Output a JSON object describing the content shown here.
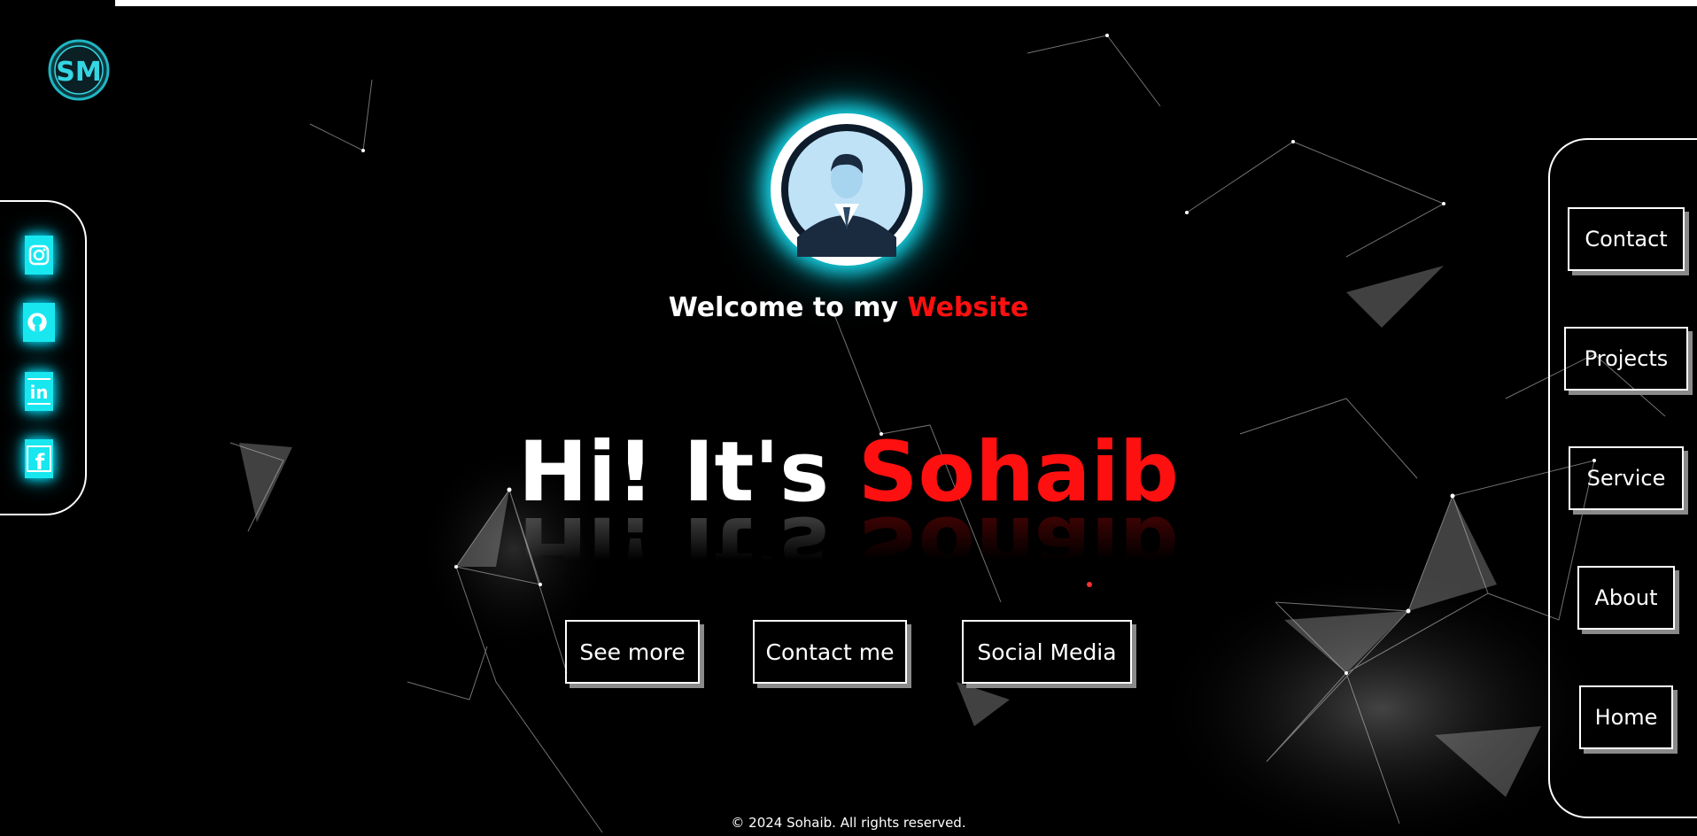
{
  "logo": {
    "text": "SM"
  },
  "social": [
    {
      "icon": "instagram-icon"
    },
    {
      "icon": "github-icon"
    },
    {
      "icon": "linkedin-icon"
    },
    {
      "icon": "facebook-icon"
    }
  ],
  "welcome": {
    "prefix": "Welcome to my ",
    "highlight": "Website"
  },
  "hero": {
    "prefix": "Hi! It's ",
    "name": "Sohaib"
  },
  "buttons": {
    "see_more": "See more",
    "contact_me": "Contact me",
    "social_media": "Social Media"
  },
  "nav": [
    "Contact",
    "Projects",
    "Service",
    "About",
    "Home"
  ],
  "footer": "© 2024 Sohaib. All rights reserved.",
  "colors": {
    "accent": "#ff1010",
    "glow": "#19e7f0",
    "background": "#000000"
  }
}
